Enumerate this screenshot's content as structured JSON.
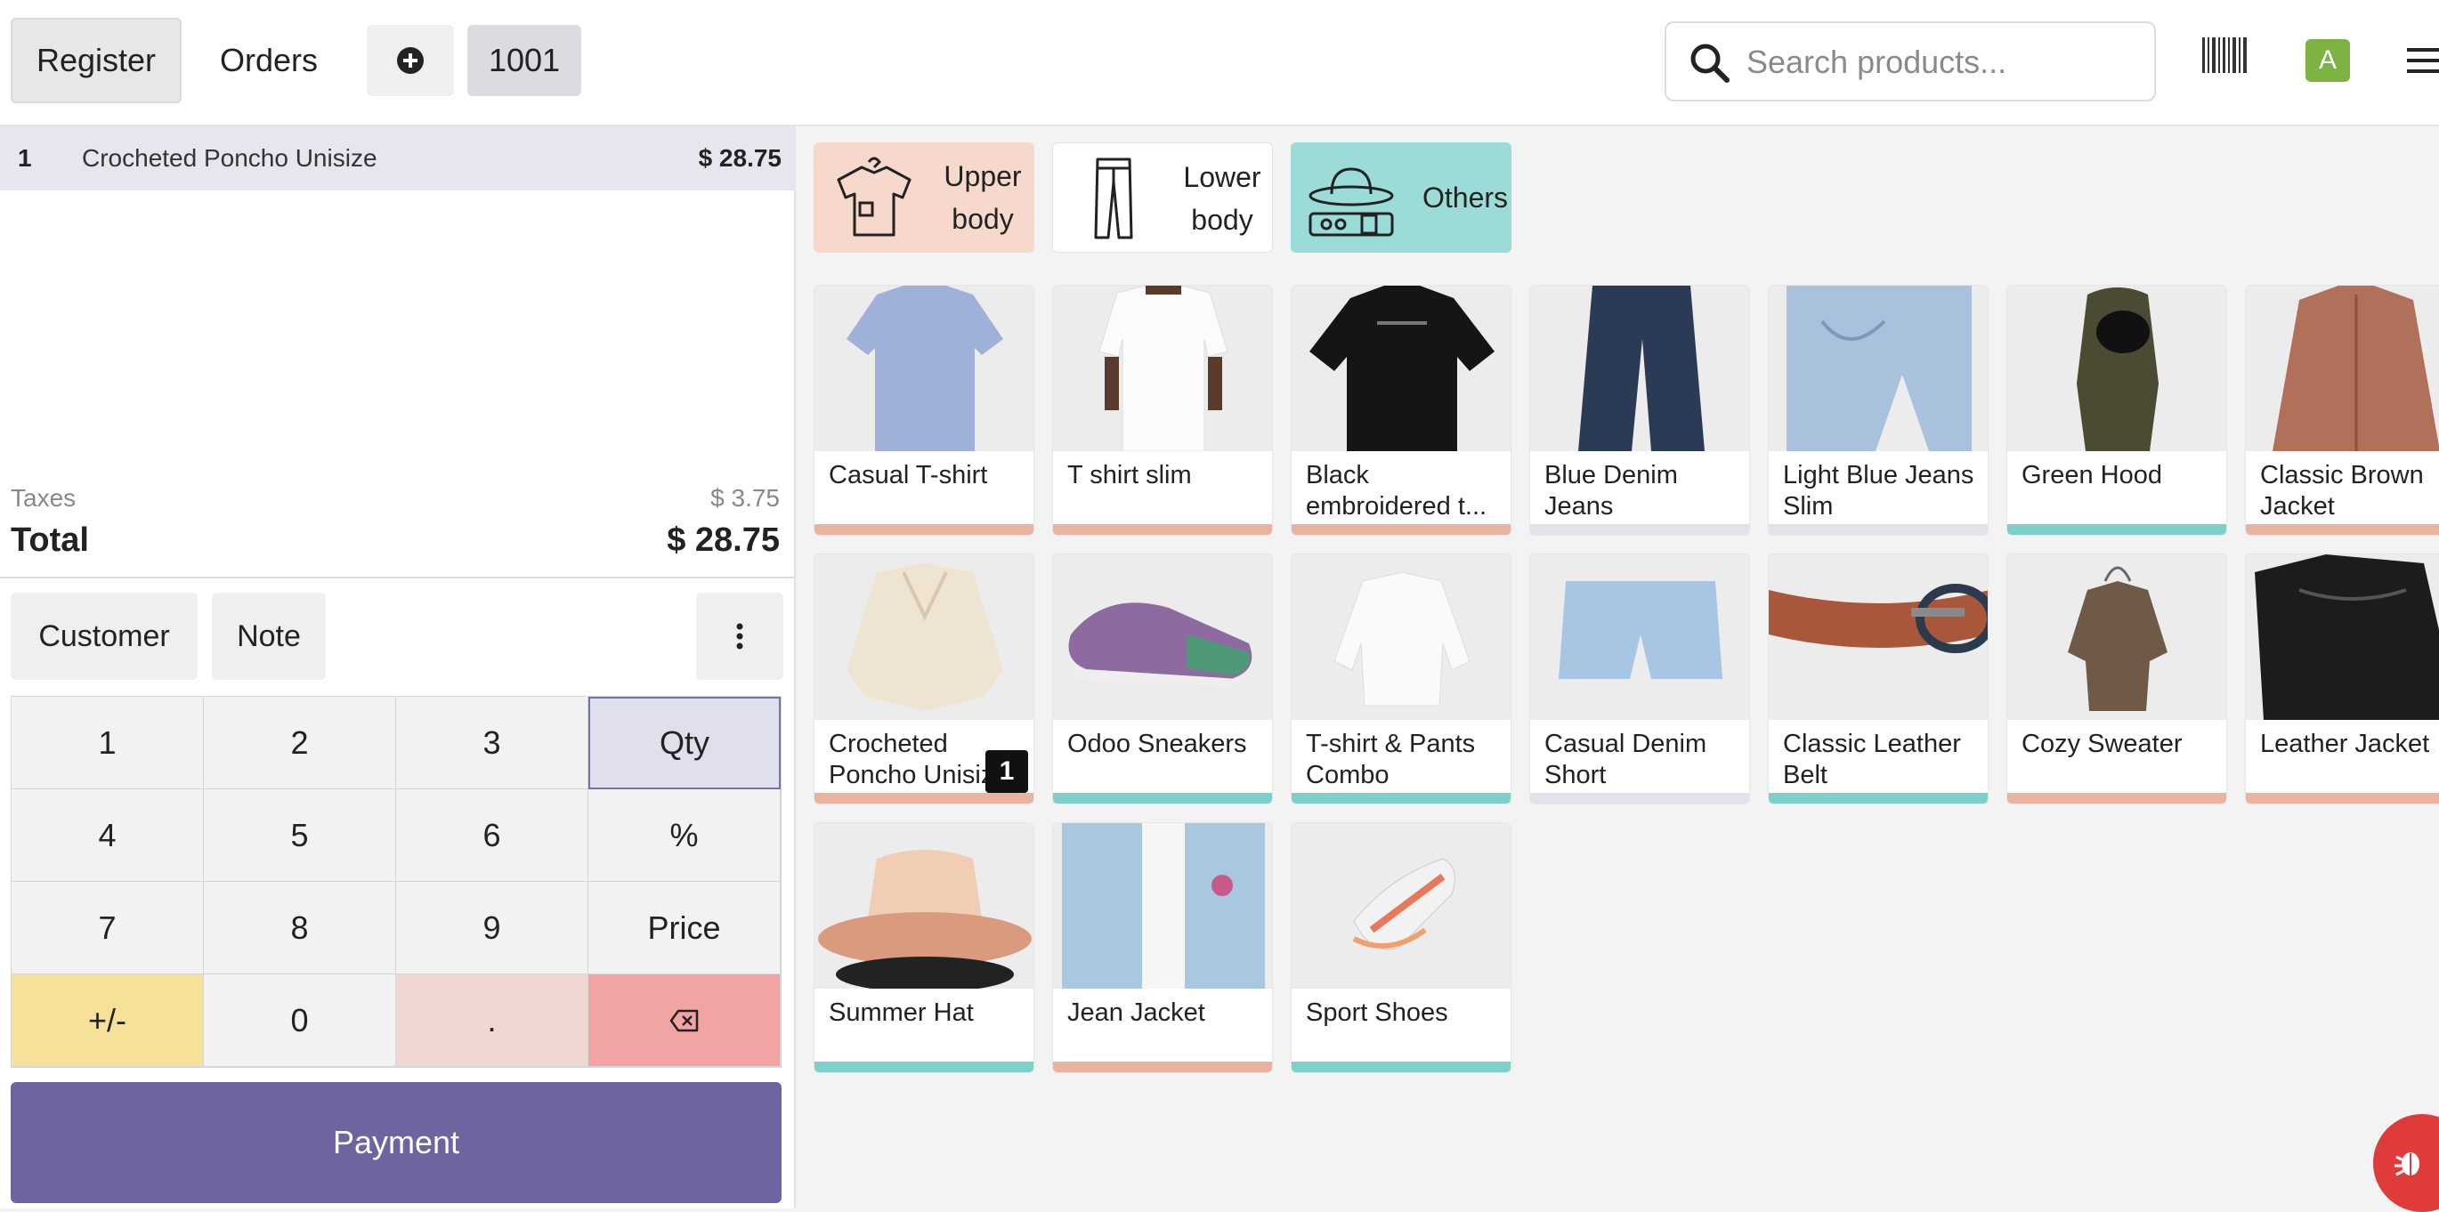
{
  "header": {
    "register_label": "Register",
    "orders_label": "Orders",
    "add_order_icon": "plus-circle-icon",
    "order_number": "1001",
    "search_placeholder": "Search products...",
    "avatar_initial": "A"
  },
  "order": {
    "lines": [
      {
        "qty": "1",
        "name": "Crocheted Poncho Unisize",
        "price": "$ 28.75"
      }
    ],
    "taxes_label": "Taxes",
    "taxes_value": "$ 3.75",
    "total_label": "Total",
    "total_value": "$ 28.75"
  },
  "controls": {
    "customer_label": "Customer",
    "note_label": "Note"
  },
  "numpad": {
    "keys": [
      "1",
      "2",
      "3",
      "Qty",
      "4",
      "5",
      "6",
      "%",
      "7",
      "8",
      "9",
      "Price",
      "+/-",
      "0",
      "."
    ]
  },
  "payment_label": "Payment",
  "categories": [
    {
      "label": "Upper body",
      "icon": "shirt-icon",
      "color": "#f6d8cd"
    },
    {
      "label": "Lower body",
      "icon": "pants-icon",
      "color": "#ffffff"
    },
    {
      "label": "Others",
      "icon": "hat-belt-icon",
      "color": "#9bdcd9"
    }
  ],
  "products": [
    {
      "name": "Casual T-shirt",
      "color": "#e8b39f"
    },
    {
      "name": "T shirt slim",
      "color": "#e8b39f"
    },
    {
      "name": "Black embroidered t...",
      "color": "#e8b39f"
    },
    {
      "name": "Blue Denim Jeans",
      "color": "#e2e2ea"
    },
    {
      "name": "Light Blue Jeans Slim",
      "color": "#e2e2ea"
    },
    {
      "name": "Green Hood",
      "color": "#7dcfc9"
    },
    {
      "name": "Classic Brown Jacket",
      "color": "#e8b39f"
    },
    {
      "name": "Crocheted Poncho Unisize",
      "color": "#e8b39f",
      "badge": "1"
    },
    {
      "name": "Odoo Sneakers",
      "color": "#7dcfc9"
    },
    {
      "name": "T-shirt & Pants Combo",
      "color": "#7dcfc9"
    },
    {
      "name": "Casual Denim Short",
      "color": "#e2e2ea"
    },
    {
      "name": "Classic Leather Belt",
      "color": "#7dcfc9"
    },
    {
      "name": "Cozy Sweater",
      "color": "#e8b39f"
    },
    {
      "name": "Leather Jacket",
      "color": "#e8b39f"
    },
    {
      "name": "Summer Hat",
      "color": "#7dcfc9"
    },
    {
      "name": "Jean Jacket",
      "color": "#e8b39f"
    },
    {
      "name": "Sport Shoes",
      "color": "#7dcfc9"
    }
  ]
}
